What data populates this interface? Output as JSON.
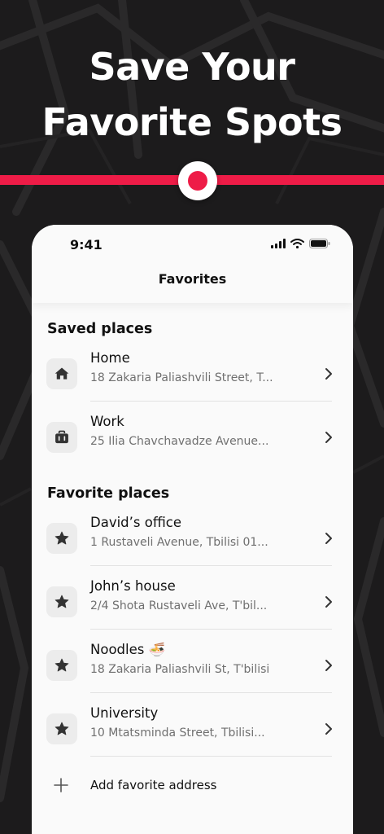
{
  "headline": {
    "line1": "Save Your",
    "line2": "Favorite Spots"
  },
  "colors": {
    "accent": "#ee1c47",
    "background": "#1c1b1c",
    "card": "#fafafa"
  },
  "status_bar": {
    "time": "9:41",
    "icons": [
      "signal-icon",
      "wifi-icon",
      "battery-icon"
    ]
  },
  "nav": {
    "title": "Favorites"
  },
  "saved_section": {
    "title": "Saved places",
    "items": [
      {
        "icon": "home-icon",
        "title": "Home",
        "subtitle": "18 Zakaria Paliashvili Street, T..."
      },
      {
        "icon": "briefcase-icon",
        "title": "Work",
        "subtitle": "25 Ilia Chavchavadze Avenue..."
      }
    ]
  },
  "favorite_section": {
    "title": "Favorite places",
    "items": [
      {
        "icon": "star-icon",
        "title": "David’s office",
        "subtitle": "1 Rustaveli Avenue, Tbilisi 01..."
      },
      {
        "icon": "star-icon",
        "title": "John’s house",
        "subtitle": "2/4 Shota Rustaveli Ave, T'bil..."
      },
      {
        "icon": "star-icon",
        "title": "Noodles 🍜",
        "subtitle": "18 Zakaria Paliashvili St, T'bilisi"
      },
      {
        "icon": "star-icon",
        "title": "University",
        "subtitle": "10 Mtatsminda Street, Tbilisi..."
      }
    ]
  },
  "add_favorite": {
    "icon": "plus-icon",
    "label": "Add favorite address"
  }
}
